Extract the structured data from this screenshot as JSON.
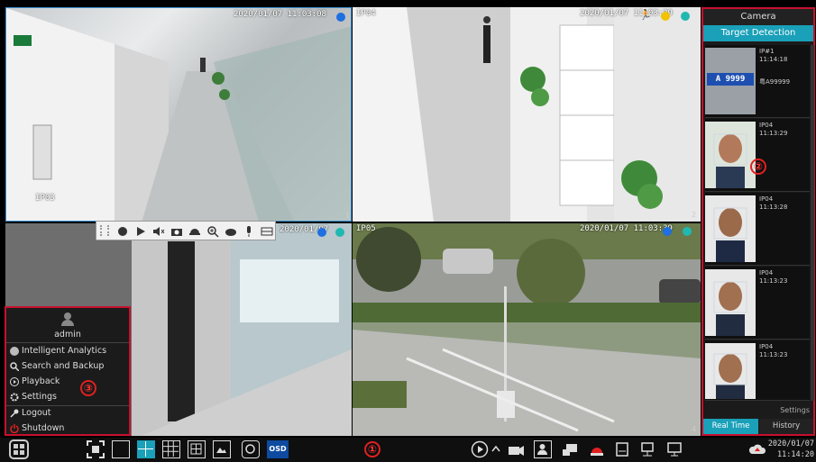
{
  "cameras": [
    {
      "id": "cam1",
      "label": "IP03",
      "timestamp": "2020/01/07 11:03:08",
      "index": "1"
    },
    {
      "id": "cam2",
      "label": "IP04",
      "timestamp": "2020/01/07 11:03:39",
      "index": "2"
    },
    {
      "id": "cam3",
      "label": "",
      "timestamp": "2020/01/07",
      "index": "3"
    },
    {
      "id": "cam4",
      "label": "IP05",
      "timestamp": "2020/01/07 11:03:39",
      "index": "4"
    }
  ],
  "right_panel": {
    "tab_camera": "Camera",
    "tab_detection": "Target Detection",
    "callout": "②",
    "settings": "Settings",
    "tab_realtime": "Real Time",
    "tab_history": "History",
    "items": [
      {
        "cam": "IP#1",
        "time": "11:14:18",
        "extra": "粤A99999",
        "plate": "A 9999"
      },
      {
        "cam": "IP04",
        "time": "11:13:29",
        "extra": ""
      },
      {
        "cam": "IP04",
        "time": "11:13:28",
        "extra": ""
      },
      {
        "cam": "IP04",
        "time": "11:13:23",
        "extra": ""
      },
      {
        "cam": "IP04",
        "time": "11:13:23",
        "extra": ""
      }
    ]
  },
  "menu": {
    "user": "admin",
    "callout": "③",
    "items": [
      "Intelligent Analytics",
      "Search and Backup",
      "Playback",
      "Settings",
      "Logout",
      "Shutdown"
    ]
  },
  "toolbar": {
    "callout": "①",
    "osd": "OSD",
    "date": "2020/01/07",
    "time": "11:14:20"
  },
  "colors": {
    "accent": "#1aa0b8",
    "highlight": "#c8102e",
    "status_blue": "#1e6fe0"
  }
}
